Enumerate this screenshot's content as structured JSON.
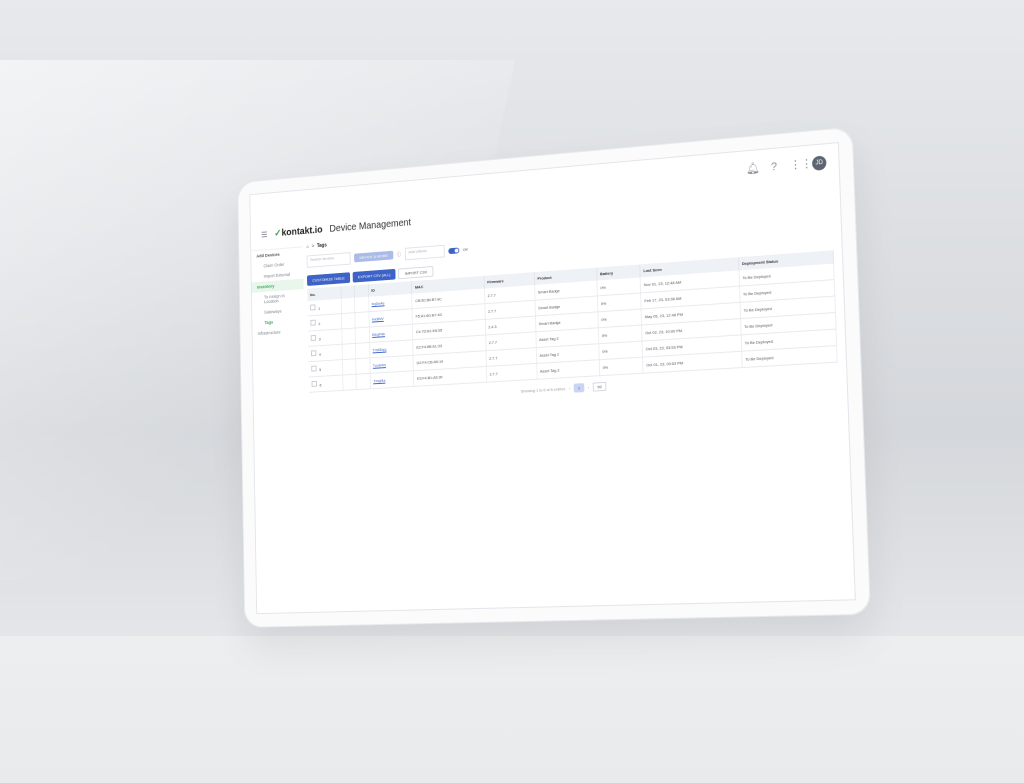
{
  "app": {
    "logo": "kontakt.io",
    "logo_mark": "✓",
    "title": "Device Management"
  },
  "sidebar": {
    "items": [
      {
        "label": "Add Devices",
        "kind": "group"
      },
      {
        "label": "Claim Order",
        "kind": "sub"
      },
      {
        "label": "Import External",
        "kind": "sub"
      },
      {
        "label": "Inventory",
        "kind": "active-group"
      },
      {
        "label": "To Assign in Location",
        "kind": "sub"
      },
      {
        "label": "Gateways",
        "kind": "sub"
      },
      {
        "label": "Tags",
        "kind": "active"
      },
      {
        "label": "Infrastructure",
        "kind": "plain"
      }
    ]
  },
  "breadcrumb": {
    "sep": ">",
    "current": "Tags"
  },
  "filters": {
    "search_placeholder": "Search devices",
    "devices_button": "DEVICE & MORE",
    "select_placeholder": "Add criteria",
    "toggle_label": "Off"
  },
  "actions": {
    "customize": "CUSTOMIZE TABLE",
    "export": "EXPORT CSV (ALL)",
    "import": "IMPORT CSV"
  },
  "table": {
    "headers": [
      "No.",
      "",
      "",
      "ID",
      "MAC",
      "Firmware",
      "Product",
      "Battery",
      "Last Seen",
      "Deployment Status"
    ],
    "rows": [
      [
        "1",
        "",
        "",
        "bqDnAe",
        "CB:50:3B:B7:9C",
        "2.7.7",
        "Smart Badge",
        "0%",
        "Nov 01, 23, 12:48 AM",
        "To Be Deployed"
      ],
      [
        "2",
        "",
        "",
        "Hx3fdV",
        "F5:A1:6D:B7:4D",
        "2.7.7",
        "Smart Badge",
        "0%",
        "Feb 17, 23, 03:38 AM",
        "To Be Deployed"
      ],
      [
        "3",
        "",
        "",
        "B4qP4b",
        "C4:7D:B1:E6:55",
        "2.4.3",
        "Smart Badge",
        "0%",
        "May 05, 23, 12:48 PM",
        "To Be Deployed"
      ],
      [
        "4",
        "",
        "",
        "Tm8Dqq",
        "E2:F4:8B:A1:33",
        "2.7.7",
        "Asset Tag 2",
        "0%",
        "Oct 02, 23, 10:00 PM",
        "To Be Deployed"
      ],
      [
        "5",
        "",
        "",
        "Tuo64m",
        "D2:F4:CB:A5:19",
        "2.7.7",
        "Asset Tag 2",
        "0%",
        "Oct 03, 23, 03:53 PM",
        "To Be Deployed"
      ],
      [
        "6",
        "",
        "",
        "Tmqf4a",
        "E3:F4:B1:A5:3F",
        "2.7.7",
        "Asset Tag 2",
        "0%",
        "Oct 01, 23, 03:53 PM",
        "To Be Deployed"
      ]
    ]
  },
  "pager": {
    "summary": "Showing 1 to 6 of 6 entries",
    "prev": "‹",
    "current": "1",
    "next": "›",
    "per_page": "50"
  },
  "icons": {
    "bell": "bell-icon",
    "help": "help-icon",
    "apps": "apps-grid-icon"
  },
  "user": {
    "initials": "JD"
  }
}
